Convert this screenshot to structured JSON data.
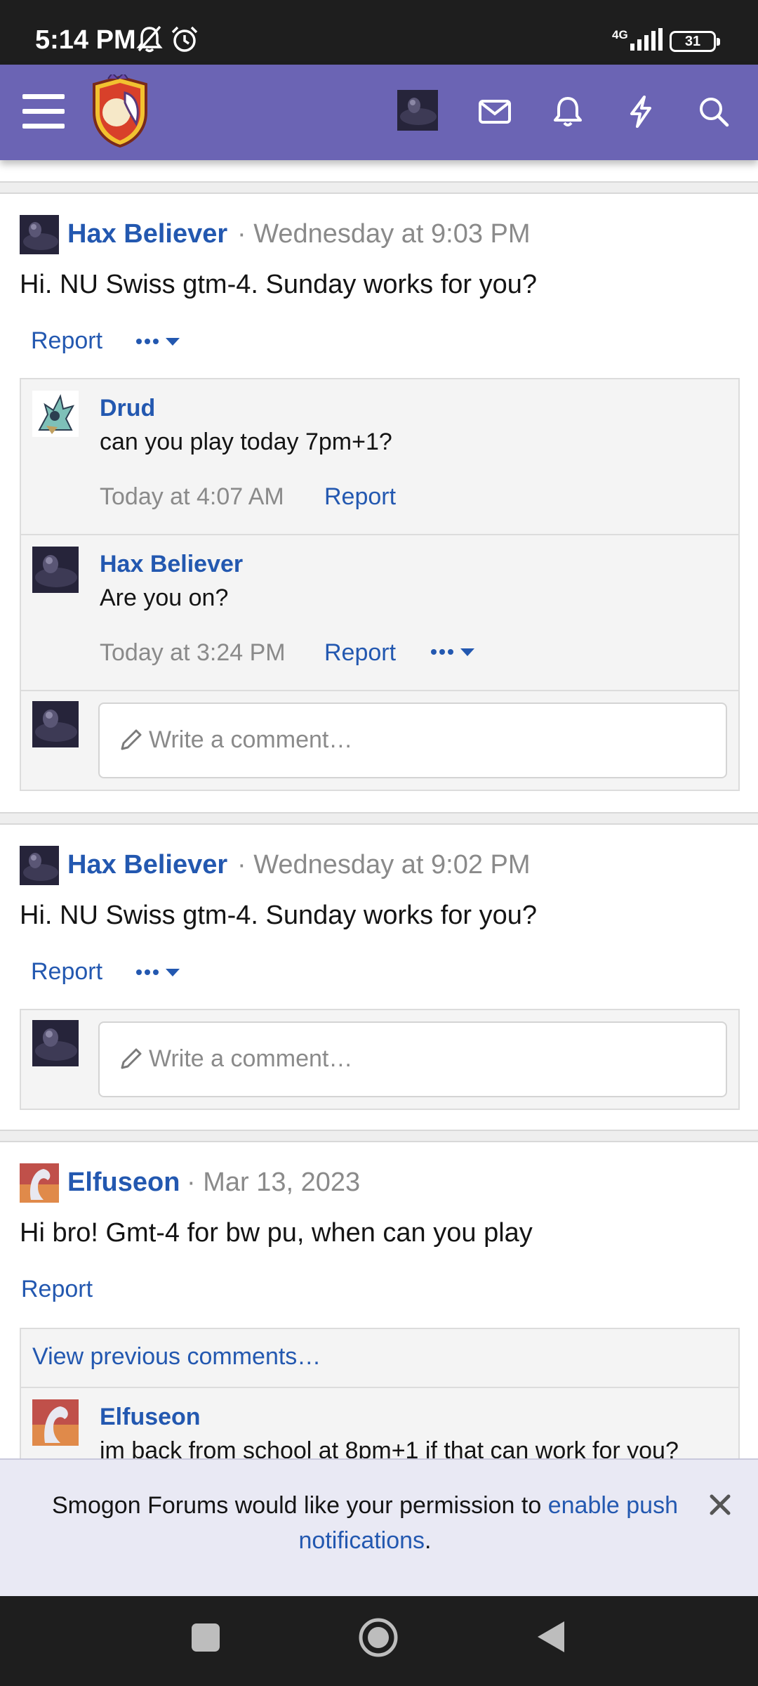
{
  "status_bar": {
    "time": "5:14 PM",
    "network": "4G",
    "battery": "31"
  },
  "header": {
    "icons": [
      "menu-icon",
      "site-logo",
      "user-avatar",
      "inbox-icon",
      "alerts-icon",
      "whats-new-icon",
      "search-icon"
    ],
    "accent_color": "#6b64b4"
  },
  "posts": [
    {
      "author": "Hax Believer",
      "meta": "· Wednesday at 9:03 PM",
      "body": "Hi. NU Swiss gtm-4. Sunday works for you?",
      "report": "Report",
      "comments": [
        {
          "author": "Drud",
          "text": "can you play today 7pm+1?",
          "date": "Today at 4:07 AM",
          "report": "Report"
        },
        {
          "author": "Hax Believer",
          "text": "Are you on?",
          "date": "Today at 3:24 PM",
          "report": "Report"
        }
      ],
      "comment_placeholder": "Write a comment…"
    },
    {
      "author": "Hax Believer",
      "meta": "· Wednesday at 9:02 PM",
      "body": "Hi. NU Swiss gtm-4. Sunday works for you?",
      "report": "Report",
      "comment_placeholder": "Write a comment…"
    },
    {
      "author": "Elfuseon",
      "meta": "· Mar 13, 2023",
      "body": "Hi bro! Gmt-4 for bw pu, when can you play",
      "report": "Report",
      "view_previous": "View previous comments…",
      "comments": [
        {
          "author": "Elfuseon",
          "text": "im back from school at 8pm+1 if that can work for you?"
        }
      ]
    }
  ],
  "push_banner": {
    "text_before": "Smogon Forums would like your permission to ",
    "link": "enable push notifications",
    "text_after": "."
  },
  "link_color": "#2358b0"
}
